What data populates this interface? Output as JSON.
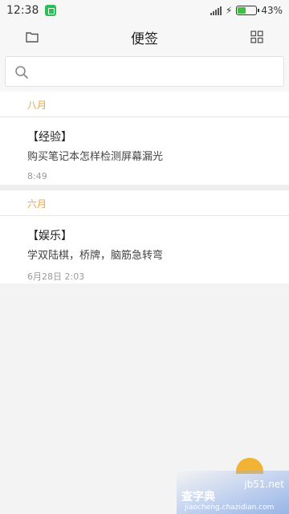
{
  "status_bar": {
    "time": "12:38",
    "battery_percent": "43%",
    "battery_level": 0.43
  },
  "header": {
    "title": "便签",
    "left_icon": "folder-icon",
    "right_icon": "grid-icon"
  },
  "search": {
    "placeholder": "",
    "icon": "search-icon"
  },
  "sections": [
    {
      "month": "八月",
      "notes": [
        {
          "title": "【经验】",
          "body": "购买笔记本怎样检测屏幕漏光",
          "time": "8:49"
        }
      ]
    },
    {
      "month": "六月",
      "notes": [
        {
          "title": "【娱乐】",
          "body": "学双陆棋，桥牌，脑筋急转弯",
          "time": "6月28日 2:03"
        }
      ]
    }
  ],
  "watermark": {
    "text_1": "查字典",
    "text_2": "jb51.net",
    "text_3": "jiaocheng.chazidian.com"
  },
  "colors": {
    "accent": "#e8a33b",
    "fab": "#f2b233",
    "battery": "#3fbf3f"
  }
}
